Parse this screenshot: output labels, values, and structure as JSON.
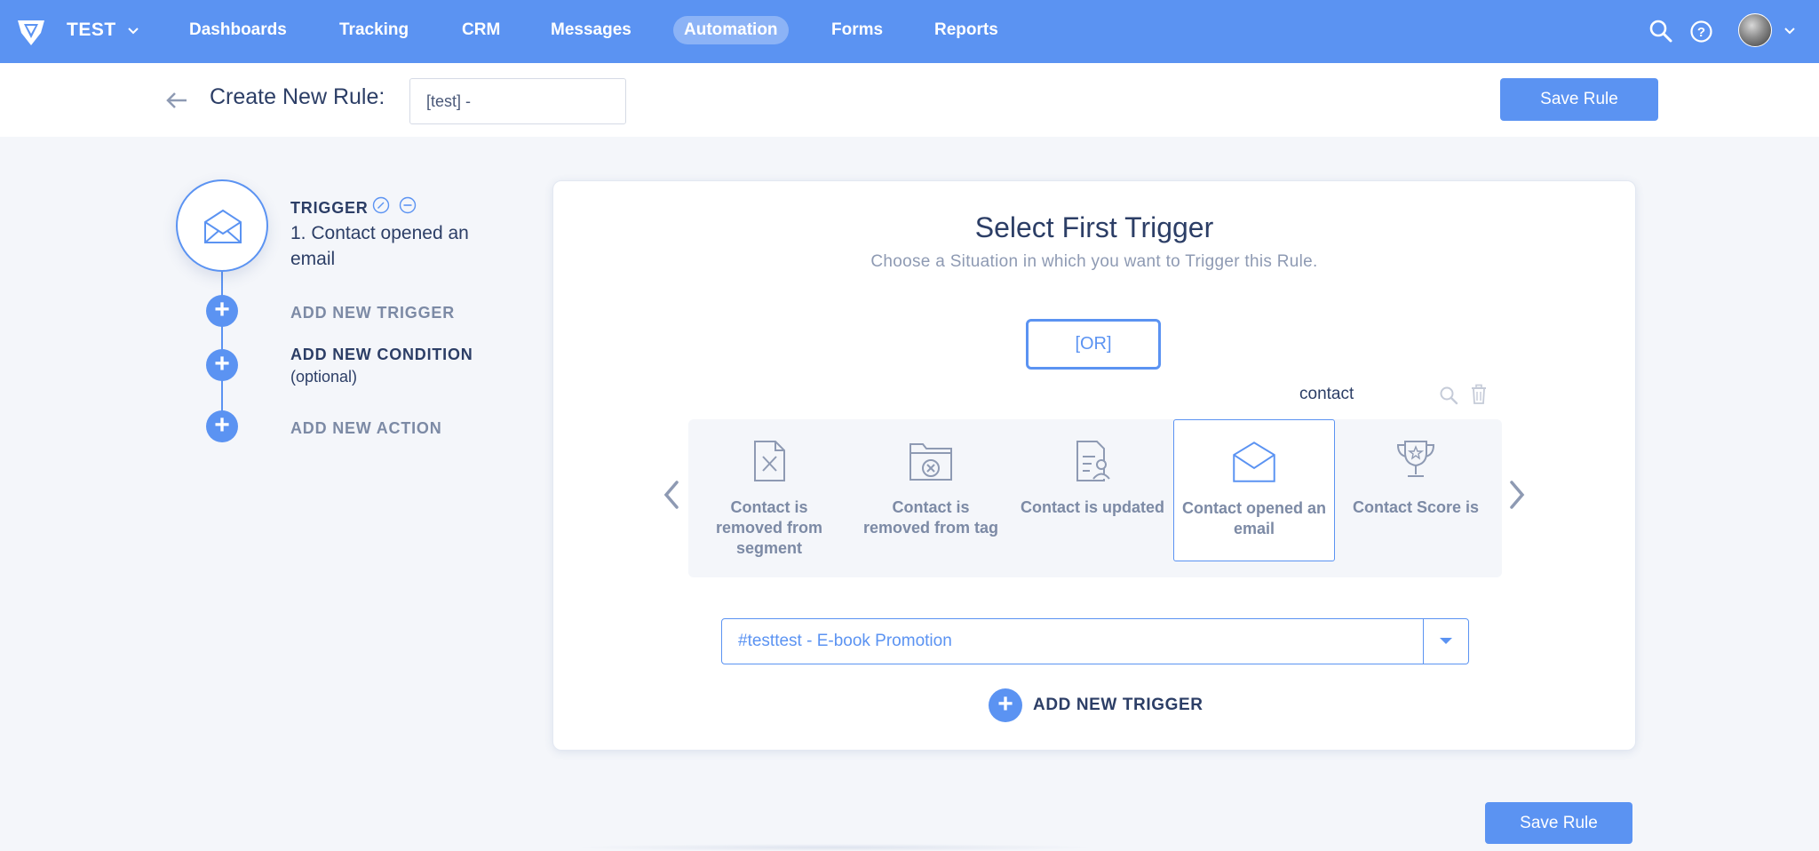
{
  "topnav": {
    "workspace": "TEST",
    "items": [
      {
        "label": "Dashboards",
        "active": false
      },
      {
        "label": "Tracking",
        "active": false
      },
      {
        "label": "CRM",
        "active": false
      },
      {
        "label": "Messages",
        "active": false
      },
      {
        "label": "Automation",
        "active": true
      },
      {
        "label": "Forms",
        "active": false
      },
      {
        "label": "Reports",
        "active": false
      }
    ],
    "icons": [
      "logo-icon",
      "search-icon",
      "help-icon",
      "avatar",
      "chevron-down-icon"
    ]
  },
  "subheader": {
    "title": "Create New Rule:",
    "rule_name_value": "[test] -",
    "save_label": "Save Rule"
  },
  "steps": {
    "trigger_title": "TRIGGER",
    "trigger_desc": "1. Contact opened an email",
    "add_trigger": "ADD NEW TRIGGER",
    "add_condition": "ADD NEW CONDITION",
    "add_condition_opt": "(optional)",
    "add_action": "ADD NEW ACTION"
  },
  "card": {
    "title": "Select First Trigger",
    "subtitle": "Choose a Situation in which you want to Trigger this Rule.",
    "or_label": "[OR]",
    "filter_text": "contact",
    "tiles": [
      {
        "label": "Contact is removed from segment",
        "icon": "file-x-icon",
        "selected": false
      },
      {
        "label": "Contact is removed from tag",
        "icon": "folder-x-icon",
        "selected": false
      },
      {
        "label": "Contact is updated",
        "icon": "contact-doc-icon",
        "selected": false
      },
      {
        "label": "Contact opened an email",
        "icon": "envelope-open-icon",
        "selected": true
      },
      {
        "label": "Contact Score is",
        "icon": "trophy-icon",
        "selected": false
      }
    ],
    "select_value": "#testtest - E-book Promotion",
    "add_trigger_label": "ADD NEW TRIGGER"
  },
  "footer": {
    "save_label": "Save Rule"
  },
  "colors": {
    "accent": "#5b93f2",
    "text_dark": "#2c3e66",
    "text_muted": "#7c8aa5",
    "background": "#f4f6fa"
  }
}
